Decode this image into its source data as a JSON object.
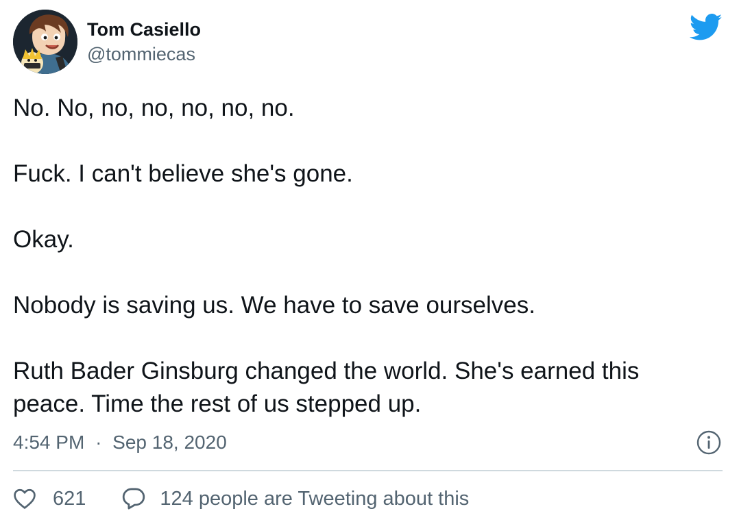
{
  "author": {
    "display_name": "Tom Casiello",
    "handle": "@tommiecas",
    "avatar_icon": "cartoon-avatar"
  },
  "brand": {
    "icon": "twitter-bird-icon",
    "color": "#1d9bf0"
  },
  "tweet": {
    "paragraphs": [
      "No. No, no, no, no, no, no.",
      "Fuck. I can't believe she's gone.",
      "Okay.",
      "Nobody is saving us. We have to save ourselves.",
      "Ruth Bader Ginsburg changed the world. She's earned this\npeace. Time the rest of us stepped up."
    ],
    "time": "4:54 PM",
    "separator": "·",
    "date": "Sep 18, 2020",
    "info_icon": "info-icon"
  },
  "engagement": {
    "like_count": "621",
    "like_icon": "heart-icon",
    "reply_icon": "speech-bubble-icon",
    "conversation_label": "124 people are Tweeting about this"
  },
  "colors": {
    "text_primary": "#0f1419",
    "text_secondary": "#536471",
    "divider": "#cfd9de"
  }
}
